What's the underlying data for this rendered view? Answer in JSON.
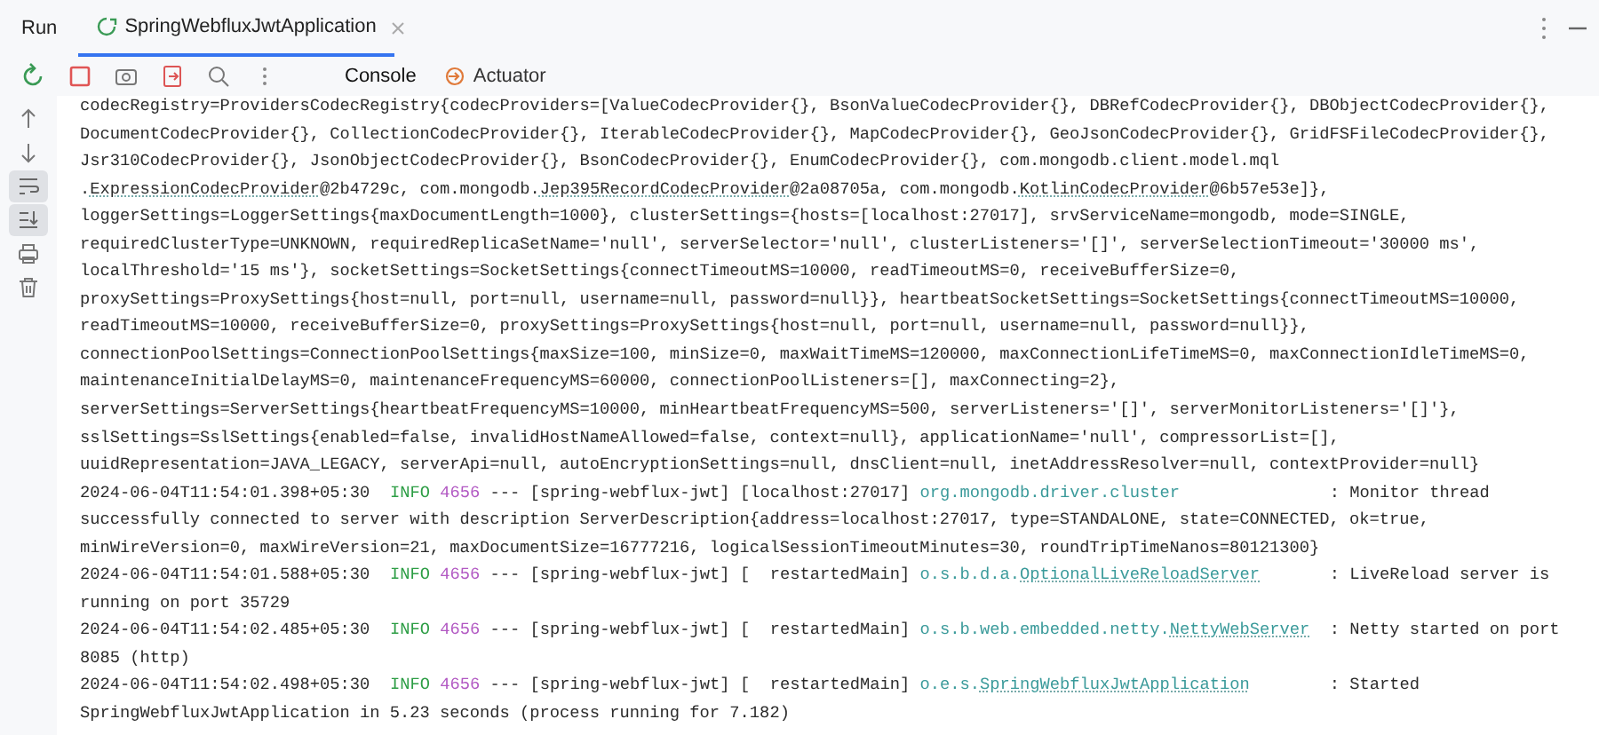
{
  "panel": {
    "title": "Run",
    "tabs": [
      {
        "label": "SpringWebfluxJwtApplication",
        "selected": true,
        "closable": true
      }
    ]
  },
  "toolbar": {
    "tabs": [
      {
        "label": "Console",
        "selected": true
      },
      {
        "label": "Actuator",
        "selected": false
      }
    ]
  },
  "console": {
    "lines": [
      {
        "kind": "text",
        "segments": [
          {
            "text": "codecRegistry=ProvidersCodecRegistry{codecProviders=[ValueCodecProvider{}, BsonValueCodecProvider{}, DBRefCodecProvider{}, DBObjectCodecProvider{},",
            "link": false
          }
        ]
      },
      {
        "kind": "text",
        "segments": [
          {
            "text": "DocumentCodecProvider{}, CollectionCodecProvider{}, IterableCodecProvider{}, MapCodecProvider{}, GeoJsonCodecProvider{}, GridFSFileCodecProvider{},",
            "link": false
          }
        ]
      },
      {
        "kind": "text",
        "segments": [
          {
            "text": "Jsr310CodecProvider{}, JsonObjectCodecProvider{}, BsonCodecProvider{}, EnumCodecProvider{}, com.mongodb.client.model.mql",
            "link": false
          }
        ]
      },
      {
        "kind": "text",
        "segments": [
          {
            "text": ".",
            "link": false
          },
          {
            "text": "ExpressionCodecProvider",
            "link": true
          },
          {
            "text": "@2b4729c, com.mongodb.",
            "link": false
          },
          {
            "text": "Jep395RecordCodecProvider",
            "link": true
          },
          {
            "text": "@2a08705a, com.mongodb.",
            "link": false
          },
          {
            "text": "KotlinCodecProvider",
            "link": true
          },
          {
            "text": "@6b57e53e]},",
            "link": false
          }
        ]
      },
      {
        "kind": "text",
        "segments": [
          {
            "text": "loggerSettings=LoggerSettings{maxDocumentLength=1000}, clusterSettings={hosts=[localhost:27017], srvServiceName=mongodb, mode=SINGLE,",
            "link": false
          }
        ]
      },
      {
        "kind": "text",
        "segments": [
          {
            "text": "requiredClusterType=UNKNOWN, requiredReplicaSetName='null', serverSelector='null', clusterListeners='[]', serverSelectionTimeout='30000 ms',",
            "link": false
          }
        ]
      },
      {
        "kind": "text",
        "segments": [
          {
            "text": "localThreshold='15 ms'}, socketSettings=SocketSettings{connectTimeoutMS=10000, readTimeoutMS=0, receiveBufferSize=0,",
            "link": false
          }
        ]
      },
      {
        "kind": "text",
        "segments": [
          {
            "text": "proxySettings=ProxySettings{host=null, port=null, username=null, password=null}}, heartbeatSocketSettings=SocketSettings{connectTimeoutMS=10000,",
            "link": false
          }
        ]
      },
      {
        "kind": "text",
        "segments": [
          {
            "text": "readTimeoutMS=10000, receiveBufferSize=0, proxySettings=ProxySettings{host=null, port=null, username=null, password=null}},",
            "link": false
          }
        ]
      },
      {
        "kind": "text",
        "segments": [
          {
            "text": "connectionPoolSettings=ConnectionPoolSettings{maxSize=100, minSize=0, maxWaitTimeMS=120000, maxConnectionLifeTimeMS=0, maxConnectionIdleTimeMS=0,",
            "link": false
          }
        ]
      },
      {
        "kind": "text",
        "segments": [
          {
            "text": "maintenanceInitialDelayMS=0, maintenanceFrequencyMS=60000, connectionPoolListeners=[], maxConnecting=2},",
            "link": false
          }
        ]
      },
      {
        "kind": "text",
        "segments": [
          {
            "text": "serverSettings=ServerSettings{heartbeatFrequencyMS=10000, minHeartbeatFrequencyMS=500, serverListeners='[]', serverMonitorListeners='[]'},",
            "link": false
          }
        ]
      },
      {
        "kind": "text",
        "segments": [
          {
            "text": "sslSettings=SslSettings{enabled=false, invalidHostNameAllowed=false, context=null}, applicationName='null', compressorList=[],",
            "link": false
          }
        ]
      },
      {
        "kind": "text",
        "segments": [
          {
            "text": "uuidRepresentation=JAVA_LEGACY, serverApi=null, autoEncryptionSettings=null, dnsClient=null, inetAddressResolver=null, contextProvider=null}",
            "link": false
          }
        ]
      },
      {
        "kind": "log",
        "timestamp": "2024-06-04T11:54:01.398+05:30",
        "level": "INFO",
        "pid": "4656",
        "dashes": "---",
        "app": "[spring-webflux-jwt]",
        "thread": "[localhost:27017]",
        "logger": [
          {
            "text": "org.mongodb.driver.cluster",
            "link": false
          }
        ],
        "message": ": Monitor thread"
      },
      {
        "kind": "text",
        "segments": [
          {
            "text": "successfully connected to server with description ServerDescription{address=localhost:27017, type=STANDALONE, state=CONNECTED, ok=true,",
            "link": false
          }
        ]
      },
      {
        "kind": "text",
        "segments": [
          {
            "text": "minWireVersion=0, maxWireVersion=21, maxDocumentSize=16777216, logicalSessionTimeoutMinutes=30, roundTripTimeNanos=80121300}",
            "link": false
          }
        ]
      },
      {
        "kind": "log",
        "timestamp": "2024-06-04T11:54:01.588+05:30",
        "level": "INFO",
        "pid": "4656",
        "dashes": "---",
        "app": "[spring-webflux-jwt]",
        "thread": "[  restartedMain]",
        "logger": [
          {
            "text": "o.s.b.d.a.",
            "link": false
          },
          {
            "text": "OptionalLiveReloadServer",
            "link": true
          }
        ],
        "message": ": LiveReload server is"
      },
      {
        "kind": "text",
        "segments": [
          {
            "text": "running on port 35729",
            "link": false
          }
        ]
      },
      {
        "kind": "log",
        "timestamp": "2024-06-04T11:54:02.485+05:30",
        "level": "INFO",
        "pid": "4656",
        "dashes": "---",
        "app": "[spring-webflux-jwt]",
        "thread": "[  restartedMain]",
        "logger": [
          {
            "text": "o.s.b.web.embedded.netty.",
            "link": false
          },
          {
            "text": "NettyWebServer",
            "link": true
          }
        ],
        "message": ": Netty started on port"
      },
      {
        "kind": "text",
        "segments": [
          {
            "text": "8085 (http)",
            "link": false
          }
        ]
      },
      {
        "kind": "log",
        "timestamp": "2024-06-04T11:54:02.498+05:30",
        "level": "INFO",
        "pid": "4656",
        "dashes": "---",
        "app": "[spring-webflux-jwt]",
        "thread": "[  restartedMain]",
        "logger": [
          {
            "text": "o.e.s.",
            "link": false
          },
          {
            "text": "SpringWebfluxJwtApplication",
            "link": true
          }
        ],
        "message": ": Started"
      },
      {
        "kind": "text",
        "segments": [
          {
            "text": "SpringWebfluxJwtApplication in 5.23 seconds (process running for 7.182)",
            "link": false
          }
        ]
      }
    ]
  }
}
